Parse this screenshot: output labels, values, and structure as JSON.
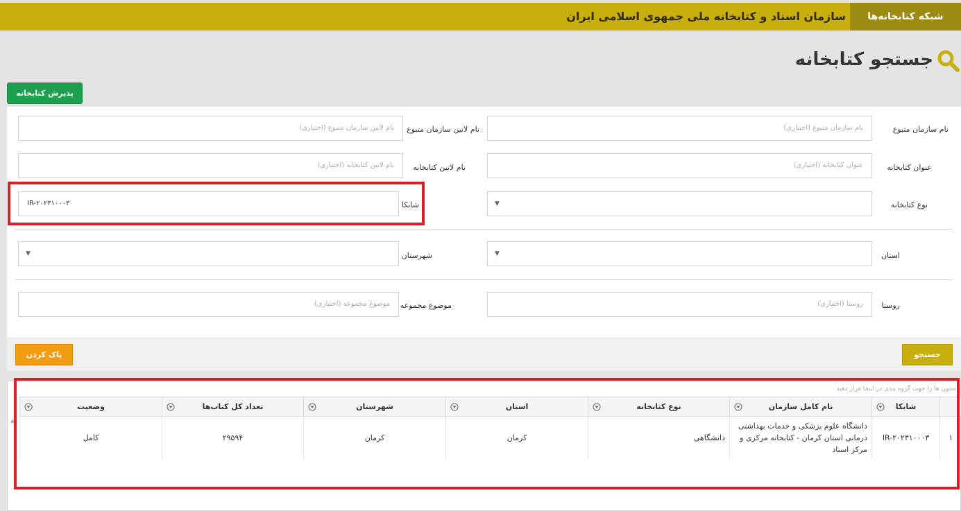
{
  "topbar": {
    "brand": "شبکه کتابخانه‌ها",
    "org_title": "سازمان اسناد و کتابخانه ملی جمهوی اسلامی ایران"
  },
  "page": {
    "title": "جستجو کتابخانه",
    "title_icon": "search-icon",
    "accept_button": "پذیرش کتابخانه"
  },
  "form": {
    "org_name": {
      "label": "نام سازمان متبوع",
      "placeholder": "نام سازمان متبوع (اختیاری)"
    },
    "org_latin": {
      "label": "نام لاتین سازمان متبوع",
      "placeholder": "نام لاتین سازمان متبوع (اختیاری)"
    },
    "library_title": {
      "label": "عنوان کتابخانه",
      "placeholder": "عنوان کتابخانه (اختیاری)"
    },
    "library_latin": {
      "label": "نام لاتین کتابخانه",
      "placeholder": "نام لاتین کتابخانه (اختیاری)"
    },
    "library_type": {
      "label": "نوع کتابخانه",
      "value": ""
    },
    "shabka": {
      "label": "شابکا",
      "value": "IR-۲۰۲۳۱۰۰۰۳"
    },
    "province": {
      "label": "استان",
      "value": ""
    },
    "city": {
      "label": "شهرستان",
      "value": ""
    },
    "village": {
      "label": "روستا",
      "placeholder": "روستا (اختیاری)"
    },
    "collection_topic": {
      "label": "موضوع مجموعه",
      "placeholder": "موضوع مجموعه (اختیاری)"
    },
    "search_button": "جستجو",
    "clear_button": "پاک کردن"
  },
  "grid": {
    "group_hint": "ستون ها را جهت گروه بندی در اینجا قرار دهید",
    "columns": [
      "شابکا",
      "نام کامل سازمان",
      "نوع کتابخانه",
      "استان",
      "شهرستان",
      "تعداد کل کتاب‌ها",
      "وضعیت"
    ],
    "rows": [
      {
        "index": "۱",
        "shabka": "IR-۲۰۲۳۱۰۰۰۳",
        "full_name": "دانشگاه علوم پزشکی و خدمات بهداشتی درمانی استان کرمان - کتابخانه مرکزی و مرکز اسناد",
        "type": "دانشگاهی",
        "province": "کرمان",
        "city": "کرمان",
        "total_books": "۲۹۵۹۴",
        "status": "کامل"
      }
    ]
  },
  "colors": {
    "topbar": "#c8ae0e",
    "brand_bg": "#9c8a12",
    "accept": "#1ca04d",
    "search": "#c8ae0e",
    "clear": "#f39c12",
    "highlight": "#d8202a"
  }
}
